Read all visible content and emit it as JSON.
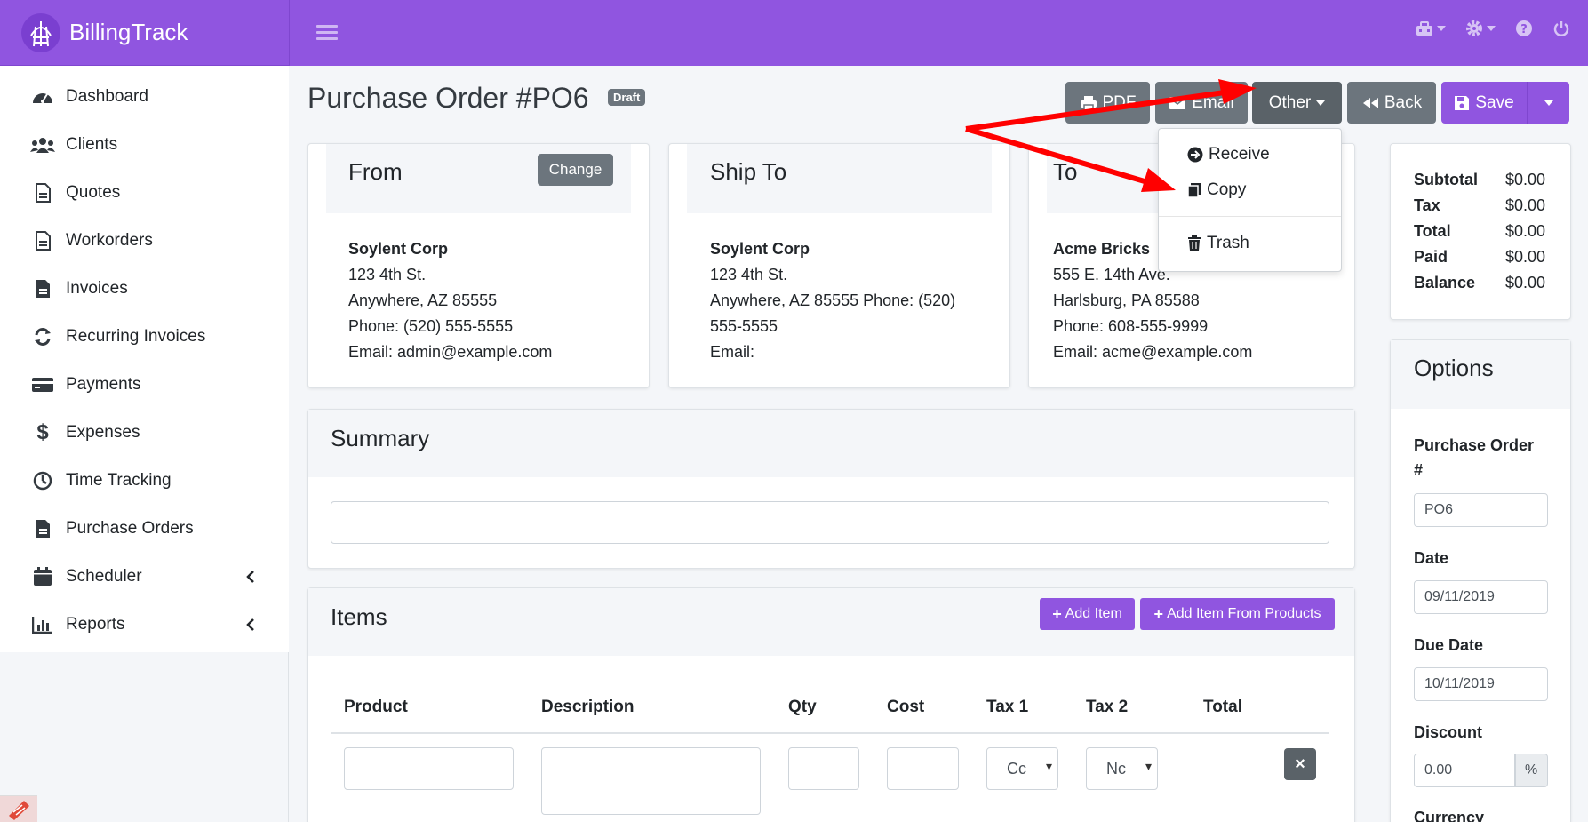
{
  "app": {
    "title": "BillingTrack"
  },
  "sidebar": {
    "items": [
      {
        "label": "Dashboard",
        "icon": "dashboard-icon"
      },
      {
        "label": "Clients",
        "icon": "users-icon"
      },
      {
        "label": "Quotes",
        "icon": "file-icon"
      },
      {
        "label": "Workorders",
        "icon": "file-icon"
      },
      {
        "label": "Invoices",
        "icon": "file-icon"
      },
      {
        "label": "Recurring Invoices",
        "icon": "sync-icon"
      },
      {
        "label": "Payments",
        "icon": "credit-card-icon"
      },
      {
        "label": "Expenses",
        "icon": "dollar-icon"
      },
      {
        "label": "Time Tracking",
        "icon": "clock-icon"
      },
      {
        "label": "Purchase Orders",
        "icon": "file-icon"
      },
      {
        "label": "Scheduler",
        "icon": "calendar-icon",
        "expandable": true
      },
      {
        "label": "Reports",
        "icon": "chart-icon",
        "expandable": true
      }
    ]
  },
  "page": {
    "title": "Purchase Order #PO6",
    "status_badge": "Draft"
  },
  "toolbar": {
    "pdf_label": "PDF",
    "email_label": "Email",
    "other_label": "Other",
    "back_label": "Back",
    "save_label": "Save"
  },
  "other_menu": {
    "receive_label": "Receive",
    "copy_label": "Copy",
    "trash_label": "Trash"
  },
  "from": {
    "title": "From",
    "change_label": "Change",
    "name": "Soylent Corp",
    "line1": "123 4th St.",
    "line2": "Anywhere, AZ 85555",
    "line3": "Phone: (520) 555-5555",
    "line4": "Email: admin@example.com"
  },
  "ship_to": {
    "title": "Ship To",
    "name": "Soylent Corp",
    "line1": "123 4th St.",
    "line2": "Anywhere, AZ 85555 Phone: (520)",
    "line3": "555-5555",
    "line4": "Email:"
  },
  "to": {
    "title": "To",
    "name": "Acme Bricks",
    "line1": "555 E. 14th Ave.",
    "line2": "Harlsburg, PA 85588",
    "line3": "Phone: 608-555-9999",
    "line4": "Email: acme@example.com"
  },
  "summary": {
    "title": "Summary",
    "value": ""
  },
  "items": {
    "title": "Items",
    "add_item_label": "Add Item",
    "add_from_products_label": "Add Item From Products",
    "columns": [
      "Product",
      "Description",
      "Qty",
      "Cost",
      "Tax 1",
      "Tax 2",
      "Total"
    ],
    "row": {
      "tax1": "Cc",
      "tax2": "Nc"
    }
  },
  "totals": {
    "labels": [
      "Subtotal",
      "Tax",
      "Total",
      "Paid",
      "Balance"
    ],
    "values": [
      "$0.00",
      "$0.00",
      "$0.00",
      "$0.00",
      "$0.00"
    ]
  },
  "options": {
    "title": "Options",
    "po_label_line1": "Purchase Order",
    "po_label_line2": "#",
    "po_value": "PO6",
    "date_label": "Date",
    "date_value": "09/11/2019",
    "due_label": "Due Date",
    "due_value": "10/11/2019",
    "discount_label": "Discount",
    "discount_value": "0.00",
    "discount_unit": "%",
    "currency_label": "Currency"
  },
  "colors": {
    "brand": "#9055e0",
    "secondary": "#6c757d",
    "annotation_arrow": "#ff0000"
  }
}
